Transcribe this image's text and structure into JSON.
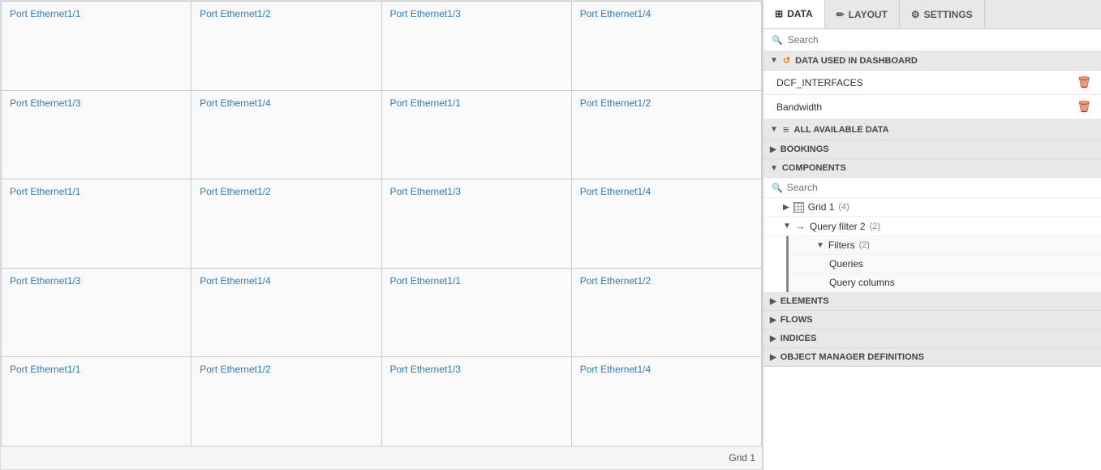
{
  "tabs": [
    {
      "id": "data",
      "label": "DATA",
      "icon": "⊞",
      "active": true
    },
    {
      "id": "layout",
      "label": "LAYOUT",
      "icon": "✏",
      "active": false
    },
    {
      "id": "settings",
      "label": "SETTINGS",
      "icon": "⚙",
      "active": false
    }
  ],
  "search": {
    "placeholder": "Search",
    "components_placeholder": "Search"
  },
  "data_used_section": {
    "label": "DATA USED IN DASHBOARD",
    "items": [
      {
        "name": "DCF_INTERFACES"
      },
      {
        "name": "Bandwidth"
      }
    ]
  },
  "all_available_section": {
    "label": "ALL AVAILABLE DATA"
  },
  "tree": {
    "bookings": {
      "label": "BOOKINGS",
      "expanded": false
    },
    "components": {
      "label": "COMPONENTS",
      "expanded": true,
      "items": [
        {
          "label": "Grid 1",
          "count": "(4)",
          "indent": 1,
          "expanded": false,
          "icon": "grid"
        },
        {
          "label": "Query filter 2",
          "count": "(2)",
          "indent": 1,
          "expanded": true,
          "icon": "arrow"
        },
        {
          "label": "Filters",
          "count": "(2)",
          "indent": 2,
          "expanded": true
        },
        {
          "label": "Queries",
          "indent": 3,
          "expanded": false
        },
        {
          "label": "Query columns",
          "indent": 3,
          "expanded": false
        }
      ]
    },
    "elements": {
      "label": "ELEMENTS",
      "expanded": false
    },
    "flows": {
      "label": "FLOWS",
      "expanded": false
    },
    "indices": {
      "label": "INDICES",
      "expanded": false
    },
    "object_manager": {
      "label": "OBJECT MANAGER DEFINITIONS",
      "expanded": false
    }
  },
  "grid": {
    "footer_label": "Grid 1",
    "rows": [
      [
        {
          "label": "Port Ethernet1/1"
        },
        {
          "label": "Port Ethernet1/2"
        },
        {
          "label": "Port Ethernet1/3"
        },
        {
          "label": "Port Ethernet1/4"
        }
      ],
      [
        {
          "label": "Port Ethernet1/3"
        },
        {
          "label": "Port Ethernet1/4"
        },
        {
          "label": "Port Ethernet1/1"
        },
        {
          "label": "Port Ethernet1/2"
        }
      ],
      [
        {
          "label": "Port Ethernet1/1"
        },
        {
          "label": "Port Ethernet1/2"
        },
        {
          "label": "Port Ethernet1/3"
        },
        {
          "label": "Port Ethernet1/4"
        }
      ],
      [
        {
          "label": "Port Ethernet1/3"
        },
        {
          "label": "Port Ethernet1/4"
        },
        {
          "label": "Port Ethernet1/1"
        },
        {
          "label": "Port Ethernet1/2"
        }
      ],
      [
        {
          "label": "Port Ethernet1/1"
        },
        {
          "label": "Port Ethernet1/2"
        },
        {
          "label": "Port Ethernet1/3"
        },
        {
          "label": "Port Ethernet1/4"
        }
      ]
    ]
  }
}
